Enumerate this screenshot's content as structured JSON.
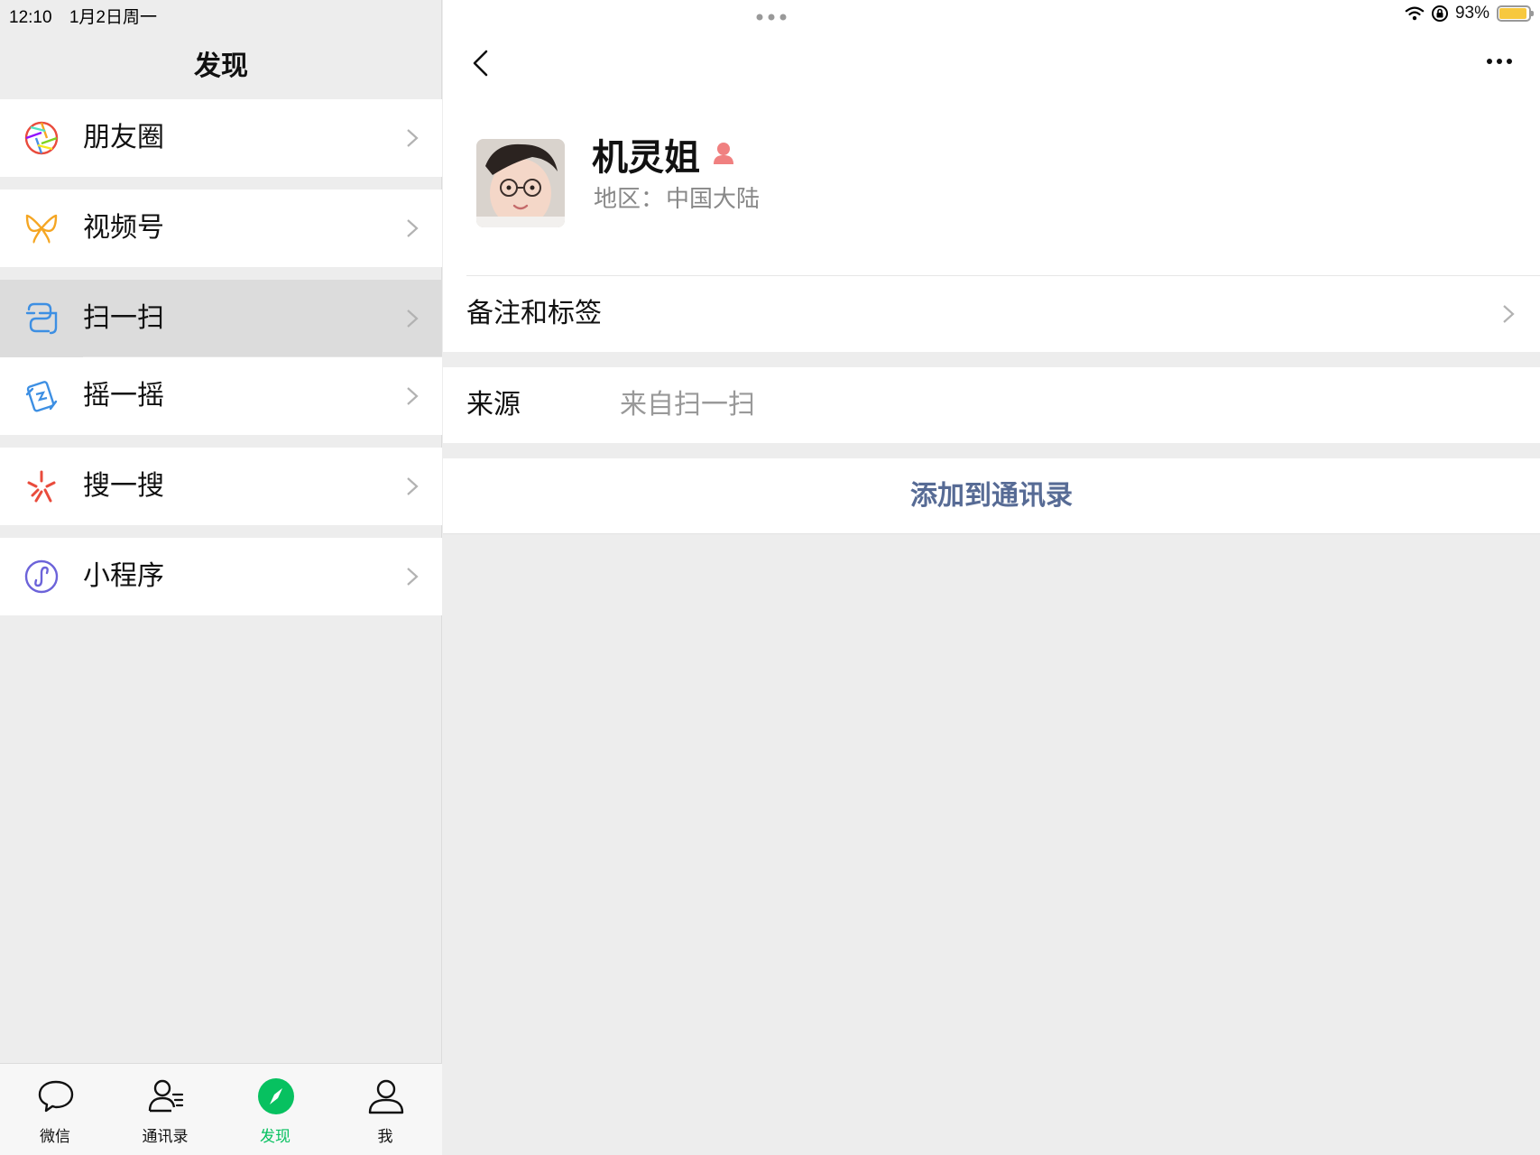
{
  "status_bar": {
    "time": "12:10",
    "date": "1月2日周一",
    "battery": "93%",
    "battery_level": 0.93,
    "icons": [
      "wifi-icon",
      "rotation-lock-icon",
      "battery-icon"
    ]
  },
  "discover": {
    "title": "发现",
    "items": [
      {
        "label": "朋友圈",
        "icon": "moments-icon"
      },
      {
        "label": "视频号",
        "icon": "channels-icon"
      },
      {
        "label": "扫一扫",
        "icon": "scan-icon",
        "active": true
      },
      {
        "label": "摇一摇",
        "icon": "shake-icon"
      },
      {
        "label": "搜一搜",
        "icon": "search-icon"
      },
      {
        "label": "小程序",
        "icon": "mini-program-icon"
      }
    ]
  },
  "tab_bar": {
    "items": [
      {
        "label": "微信",
        "icon": "chats-icon"
      },
      {
        "label": "通讯录",
        "icon": "contacts-icon"
      },
      {
        "label": "发现",
        "icon": "discover-icon",
        "active": true
      },
      {
        "label": "我",
        "icon": "me-icon"
      }
    ]
  },
  "profile": {
    "name": "机灵姐",
    "region_label": "地区：",
    "region_value": "中国大陆",
    "remark_label": "备注和标签",
    "source_label": "来源",
    "source_value": "来自扫一扫",
    "add_button": "添加到通讯录"
  },
  "colors": {
    "wechat_green": "#07c160",
    "link_blue": "#576b95",
    "battery_yellow": "#f7c83e",
    "gender_female": "#f08080"
  }
}
